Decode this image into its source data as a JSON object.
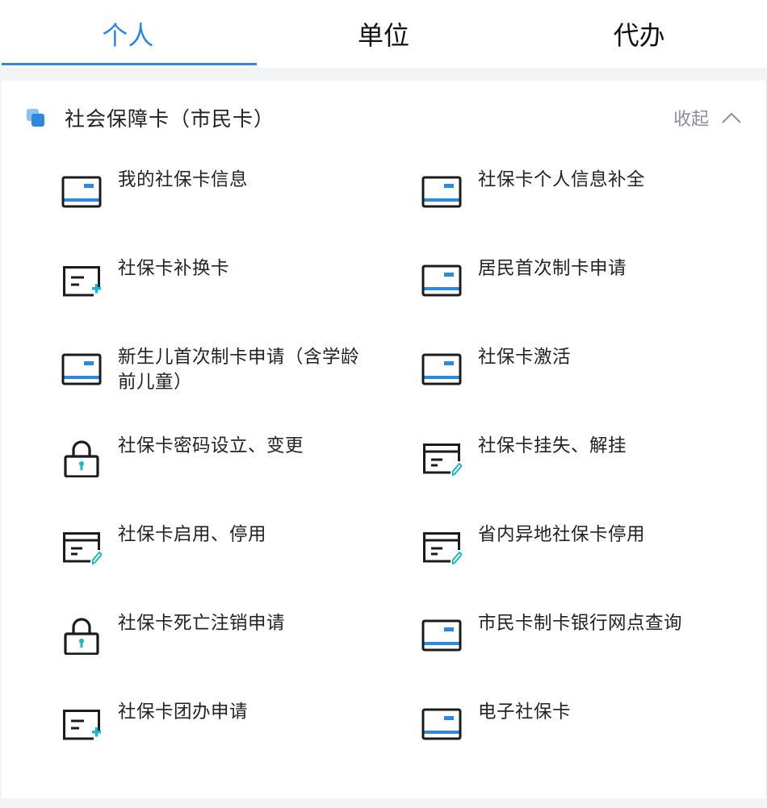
{
  "tabs": [
    {
      "label": "个人",
      "active": true
    },
    {
      "label": "单位",
      "active": false
    },
    {
      "label": "代办",
      "active": false
    }
  ],
  "section": {
    "title": "社会保障卡（市民卡）",
    "collapse_label": "收起",
    "icon": "stacked-squares-icon"
  },
  "colors": {
    "accent": "#2e88de",
    "teal": "#1fb3c6",
    "icon_dark": "#1b1b1b",
    "muted": "#8a8f99"
  },
  "items": [
    {
      "label": "我的社保卡信息",
      "icon": "card-icon"
    },
    {
      "label": "社保卡个人信息补全",
      "icon": "card-icon"
    },
    {
      "label": "社保卡补换卡",
      "icon": "card-add-icon"
    },
    {
      "label": "居民首次制卡申请",
      "icon": "card-icon"
    },
    {
      "label": "新生儿首次制卡申请（含学龄前儿童）",
      "icon": "card-icon"
    },
    {
      "label": "社保卡激活",
      "icon": "card-icon"
    },
    {
      "label": "社保卡密码设立、变更",
      "icon": "lock-icon"
    },
    {
      "label": "社保卡挂失、解挂",
      "icon": "card-edit-icon"
    },
    {
      "label": "社保卡启用、停用",
      "icon": "card-edit-icon"
    },
    {
      "label": "省内异地社保卡停用",
      "icon": "card-edit-icon"
    },
    {
      "label": "社保卡死亡注销申请",
      "icon": "lock-icon"
    },
    {
      "label": "市民卡制卡银行网点查询",
      "icon": "card-icon"
    },
    {
      "label": "社保卡团办申请",
      "icon": "card-add-icon"
    },
    {
      "label": "电子社保卡",
      "icon": "card-icon"
    }
  ]
}
